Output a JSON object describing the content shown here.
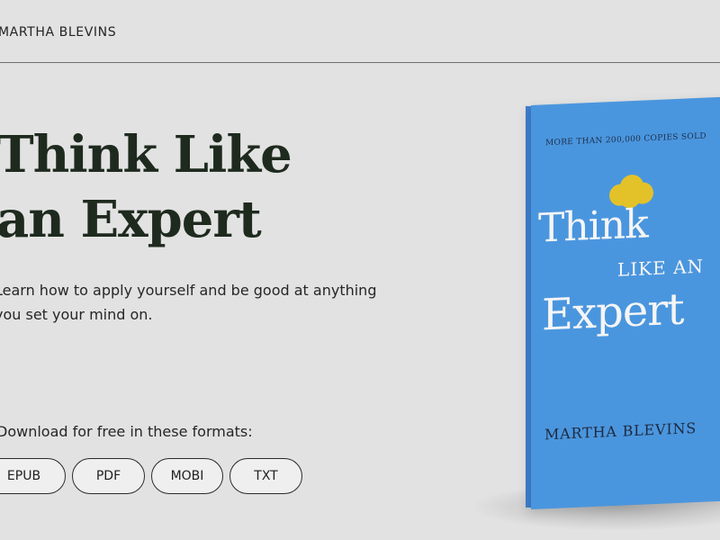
{
  "header": {
    "author": "MARTHA BLEVINS"
  },
  "hero": {
    "title_line1": "Think Like",
    "title_line2": "an Expert",
    "tagline": "Learn how to apply yourself and be good at anything you set your mind on."
  },
  "download": {
    "label": "Download for free in these formats:",
    "formats": [
      "EPUB",
      "PDF",
      "MOBI",
      "TXT"
    ]
  },
  "book": {
    "copies": "MORE THAN 200,000 COPIES SOLD",
    "title_think": "Think",
    "title_like_an": "LIKE AN",
    "title_expert": "Expert",
    "author": "MARTHA BLEVINS",
    "cover_color": "#4a96de",
    "cloud_color": "#e3c229",
    "cloud_icon": "cloud-icon"
  },
  "colors": {
    "background": "#e2e2e2",
    "title": "#1f2a1f"
  }
}
